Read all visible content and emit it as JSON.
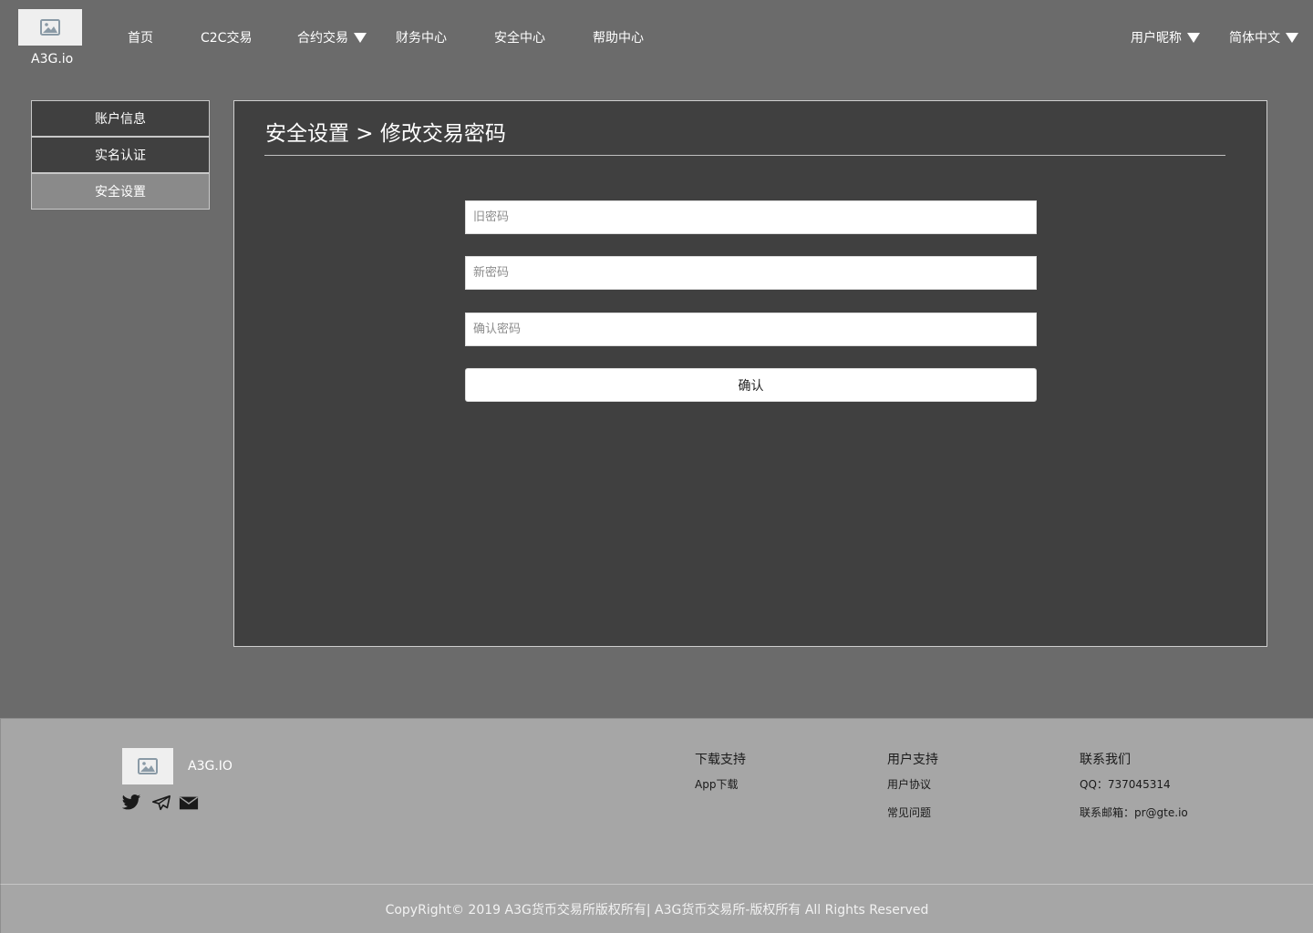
{
  "header": {
    "logo_text": "A3G.io",
    "nav": {
      "home": "首页",
      "c2c": "C2C交易",
      "contract": "合约交易",
      "finance": "财务中心",
      "security": "安全中心",
      "help": "帮助中心"
    },
    "user_nickname": "用户昵称",
    "language": "简体中文"
  },
  "sidebar": {
    "items": [
      {
        "label": "账户信息",
        "active": false
      },
      {
        "label": "实名认证",
        "active": false
      },
      {
        "label": "安全设置",
        "active": true
      }
    ]
  },
  "main": {
    "title": "安全设置 > 修改交易密码",
    "fields": {
      "old_password": {
        "placeholder": "旧密码",
        "value": ""
      },
      "new_password": {
        "placeholder": "新密码",
        "value": ""
      },
      "confirm_password": {
        "placeholder": "确认密码",
        "value": ""
      }
    },
    "confirm_button": "确认"
  },
  "footer": {
    "logo_text": "A3G.IO",
    "social_icons": [
      "twitter-icon",
      "telegram-icon",
      "mail-icon"
    ],
    "columns": {
      "download": {
        "title": "下载支持",
        "links": [
          "App下载"
        ]
      },
      "support": {
        "title": "用户支持",
        "links": [
          "用户协议",
          "常见问题"
        ]
      },
      "contact": {
        "title": "联系我们",
        "qq": "QQ：737045314",
        "email": "联系邮箱：pr@gte.io"
      }
    },
    "copyright": "CopyRight© 2019 A3G货币交易所版权所有| A3G货币交易所-版权所有 All Rights Reserved"
  },
  "colors": {
    "background": "#6b6b6b",
    "panel": "#404040",
    "sidebar_active": "#8a8a8a",
    "footer": "#a6a6a6"
  }
}
